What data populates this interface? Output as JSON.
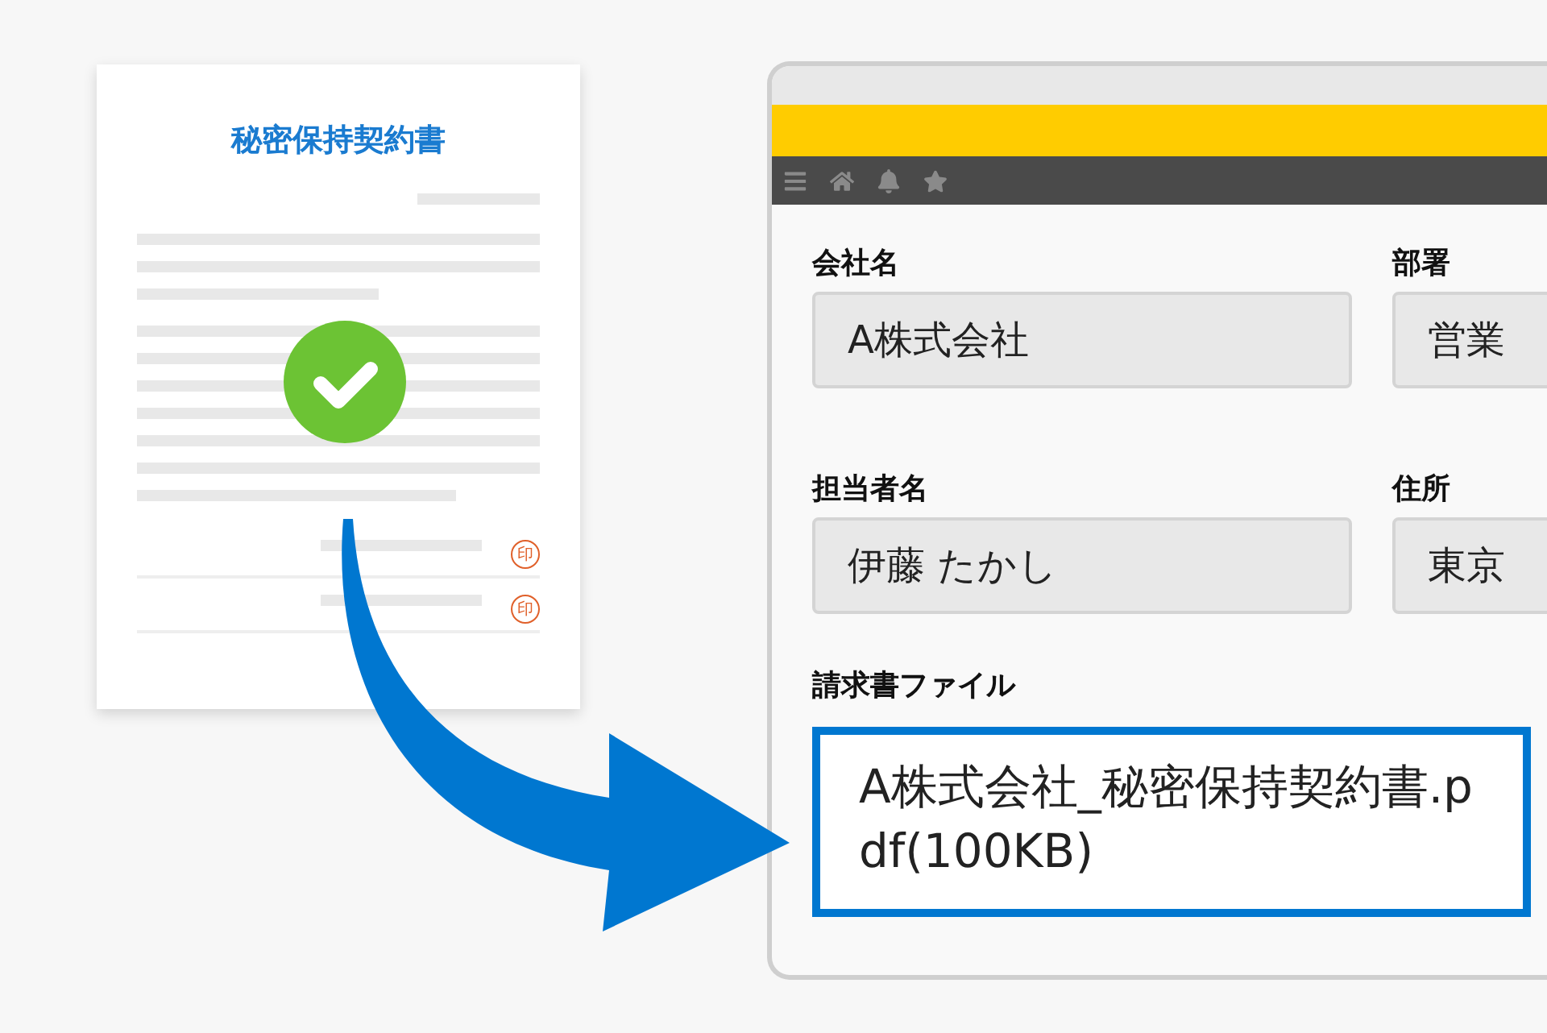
{
  "document": {
    "title": "秘密保持契約書",
    "stamps": [
      "印",
      "印"
    ]
  },
  "window": {
    "fields": [
      {
        "label": "会社名",
        "value": "A株式会社"
      },
      {
        "label": "部署",
        "value": "営業"
      },
      {
        "label": "担当者名",
        "value": "伊藤 たかし"
      },
      {
        "label": "住所",
        "value": "東京"
      }
    ],
    "file_field": {
      "label": "請求書ファイル",
      "value": "A株式会社_秘密保持契約書.pdf(100KB)"
    }
  }
}
